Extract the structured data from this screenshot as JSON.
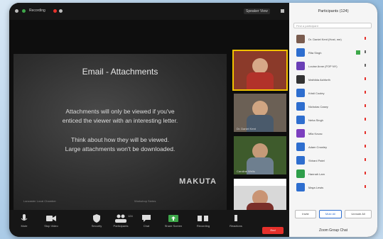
{
  "topbar": {
    "recording": "Recording",
    "view": "Speaker View"
  },
  "slide": {
    "title": "Email - Attachments",
    "lines": [
      "Attachments will only be viewed if you've",
      "enticed the viewer with an interesting letter.",
      "Think about how they will be viewed.",
      "Large attachments won't be downloaded."
    ],
    "logo": "MAKUTA",
    "footer_left": "Lancaster Local Chamber",
    "footer_right": "Workshop Series"
  },
  "thumbnails": [
    {
      "name": ""
    },
    {
      "name": "Dr. Daniel Kent"
    },
    {
      "name": "Caroline Wells"
    },
    {
      "name": ""
    }
  ],
  "participants_panel": {
    "title": "Participants (124)",
    "search_placeholder": "Find a participant",
    "participants": [
      {
        "name": "Dr. Daniel Kent (Host, me)",
        "color": "#7a5c4f"
      },
      {
        "name": "Rita Singh",
        "color": "#2e6ecf"
      },
      {
        "name": "Louise Anne (FOP NY)",
        "color": "#6a3fb6"
      },
      {
        "name": "Mathilda Ashforth",
        "color": "#333333"
      },
      {
        "name": "Kristi Cooley",
        "color": "#2e6ecf"
      },
      {
        "name": "Nicholas Casey",
        "color": "#2e6ecf"
      },
      {
        "name": "Neha Singh",
        "color": "#2e6ecf"
      },
      {
        "name": "Mila Kovac",
        "color": "#7c3fbf"
      },
      {
        "name": "Adam Crowley",
        "color": "#2e6ecf"
      },
      {
        "name": "Shirani Patel",
        "color": "#2e6ecf"
      },
      {
        "name": "Hannah Lam",
        "color": "#2e9e4a"
      },
      {
        "name": "Maya Lewis",
        "color": "#2e6ecf"
      }
    ],
    "invite": "Invite",
    "mute_all": "Mute All",
    "more": "Unmute All",
    "footer": "Zoom Group Chat"
  },
  "toolbar": {
    "mute": "Mute",
    "stop_video": "Stop Video",
    "security": "Security",
    "participants": "Participants",
    "participants_count": "124",
    "chat": "Chat",
    "share_screen": "Share Screen",
    "recording": "Recording",
    "reactions": "Reactions",
    "end": "End"
  }
}
